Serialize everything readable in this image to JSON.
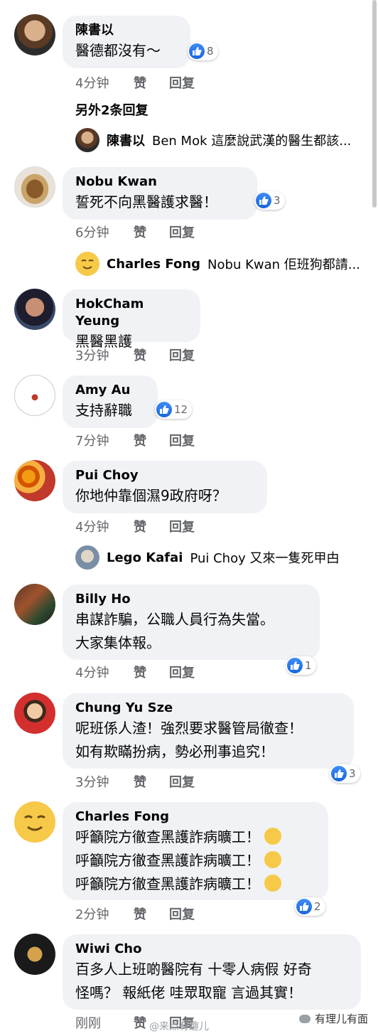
{
  "comments": [
    {
      "author": "陳書以",
      "lines": [
        "醫德都沒有～"
      ],
      "time": "4分钟",
      "likes": "8"
    },
    {
      "author": "Nobu Kwan",
      "lines": [
        "誓死不向黑醫護求醫！"
      ],
      "time": "6分钟",
      "likes": "3"
    },
    {
      "author": "HokCham Yeung",
      "lines": [
        "黑醫黑護"
      ],
      "time": "3分钟",
      "likes": ""
    },
    {
      "author": "Amy Au",
      "lines": [
        "支持辭職"
      ],
      "time": "7分钟",
      "likes": "12"
    },
    {
      "author": "Pui Choy",
      "lines": [
        "你地仲靠個濕9政府呀？"
      ],
      "time": "4分钟",
      "likes": ""
    },
    {
      "author": "Billy Ho",
      "lines": [
        "串謀詐騙，公職人員行為失當。",
        "大家集体報。"
      ],
      "time": "4分钟",
      "likes": "1"
    },
    {
      "author": "Chung Yu Sze",
      "lines": [
        "呢班係人渣！強烈要求醫管局徹查！",
        "如有欺瞞扮病，勢必刑事追究！"
      ],
      "time": "3分钟",
      "likes": "3"
    },
    {
      "author": "Charles Fong",
      "lines": [
        "呼籲院方徹查黑護詐病曠工！",
        "呼籲院方徹查黑護詐病曠工！",
        "呼籲院方徹查黑護詐病曠工！"
      ],
      "time": "2分钟",
      "likes": "2"
    },
    {
      "author": "Wiwi Cho",
      "lines": [
        "百多人上班啲醫院有 十零人病假 好奇",
        "怪嗎？ 報紙佬 哇眾取寵 言過其實！"
      ],
      "time": "刚刚",
      "likes": ""
    }
  ],
  "actions": {
    "like": "赞",
    "reply": "回复"
  },
  "more_replies": "另外2条回复",
  "replies": [
    {
      "author": "陳書以",
      "text": "Ben Mok 這麼說武漢的醫生都該..."
    },
    {
      "author": "Charles Fong",
      "text": "Nobu Kwan 佢班狗都請..."
    },
    {
      "author": "Lego Kafai",
      "text": "Pui Choy 又來一隻死甲甴"
    }
  ],
  "watermark": {
    "weibo": "@来点有趣儿",
    "wechat": "有理儿有面"
  },
  "colors": {
    "bubble": "#f0f2f5",
    "meta": "#65676b",
    "like": "#1877f2"
  }
}
